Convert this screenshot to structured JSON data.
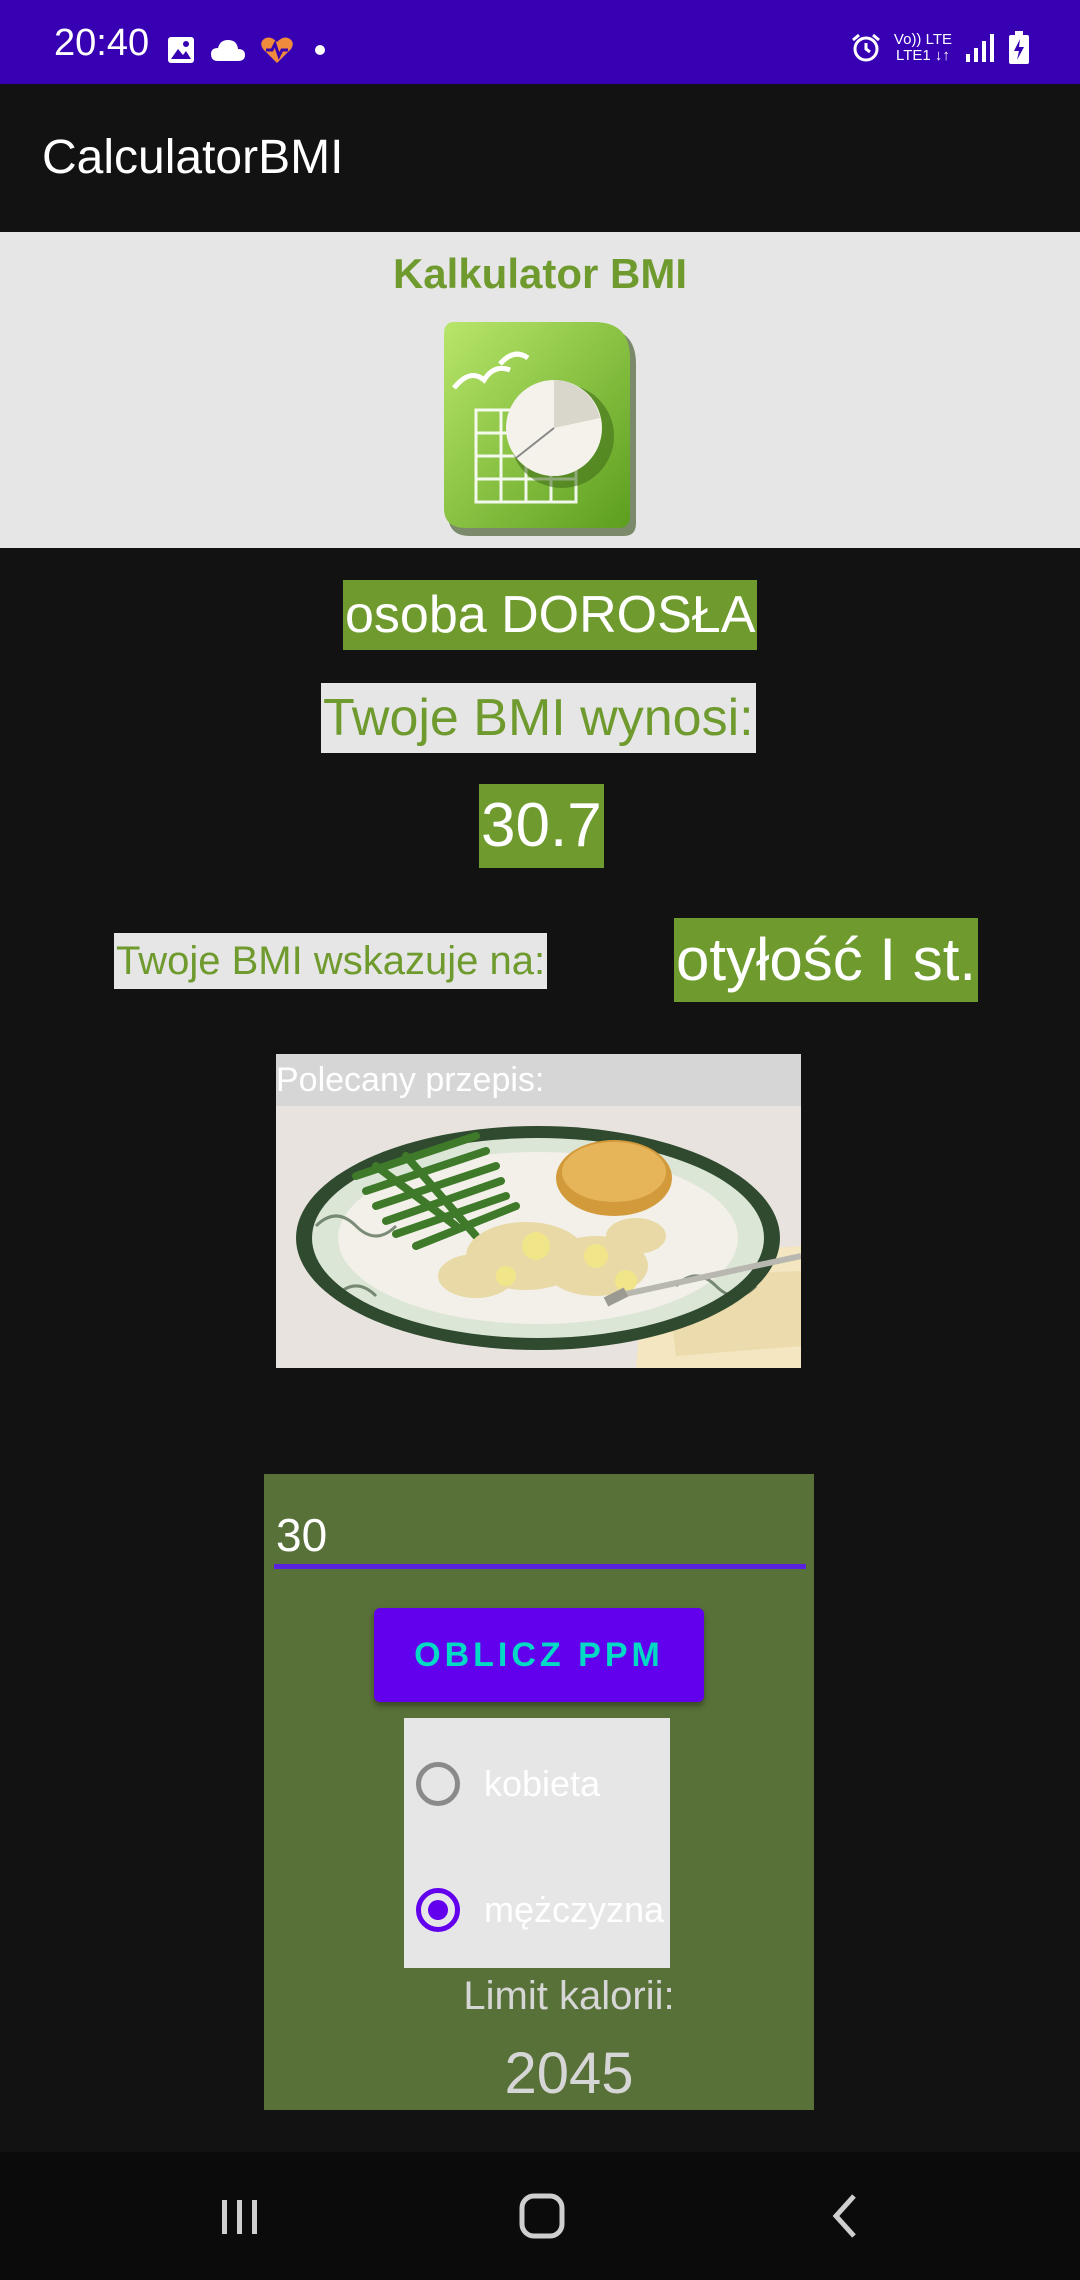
{
  "status_bar": {
    "time": "20:40",
    "lte_top": "Vo)) LTE",
    "lte_bottom": "LTE1 ↓↑",
    "icons": [
      "image-icon",
      "cloud-icon",
      "health-app-icon",
      "notification-dot-icon",
      "alarm-icon",
      "volte-icon",
      "signal-icon",
      "battery-charging-icon"
    ]
  },
  "app_bar": {
    "title": "CalculatorBMI"
  },
  "header": {
    "title": "Kalkulator BMI",
    "logo": "spreadsheet-chart-logo"
  },
  "result": {
    "category": "osoba DOROSŁA",
    "bmi_label": "Twoje BMI wynosi:",
    "bmi_value": "30.7",
    "indicates_label": "Twoje BMI wskazuje na:",
    "indicates_value": "otyłość I st."
  },
  "recipe": {
    "label": "Polecany przepis:",
    "image": "chicken-dumplings-plate-image"
  },
  "calories": {
    "age_value": "30",
    "calc_button_label": "OBLICZ PPM",
    "sex_options": [
      {
        "label": "kobieta",
        "selected": false
      },
      {
        "label": "mężczyzna",
        "selected": true
      }
    ],
    "limit_label": "Limit kalorii:",
    "limit_value": "2045"
  },
  "nav": {
    "icons": [
      "recent-apps-icon",
      "home-icon",
      "back-icon"
    ]
  },
  "colors": {
    "status_bar": "#3700B3",
    "accent_green": "#6F9A2E",
    "panel_green": "#587138",
    "button": "#6200EE",
    "button_text": "#03DAC5",
    "light_panel": "#E6E6E6"
  }
}
